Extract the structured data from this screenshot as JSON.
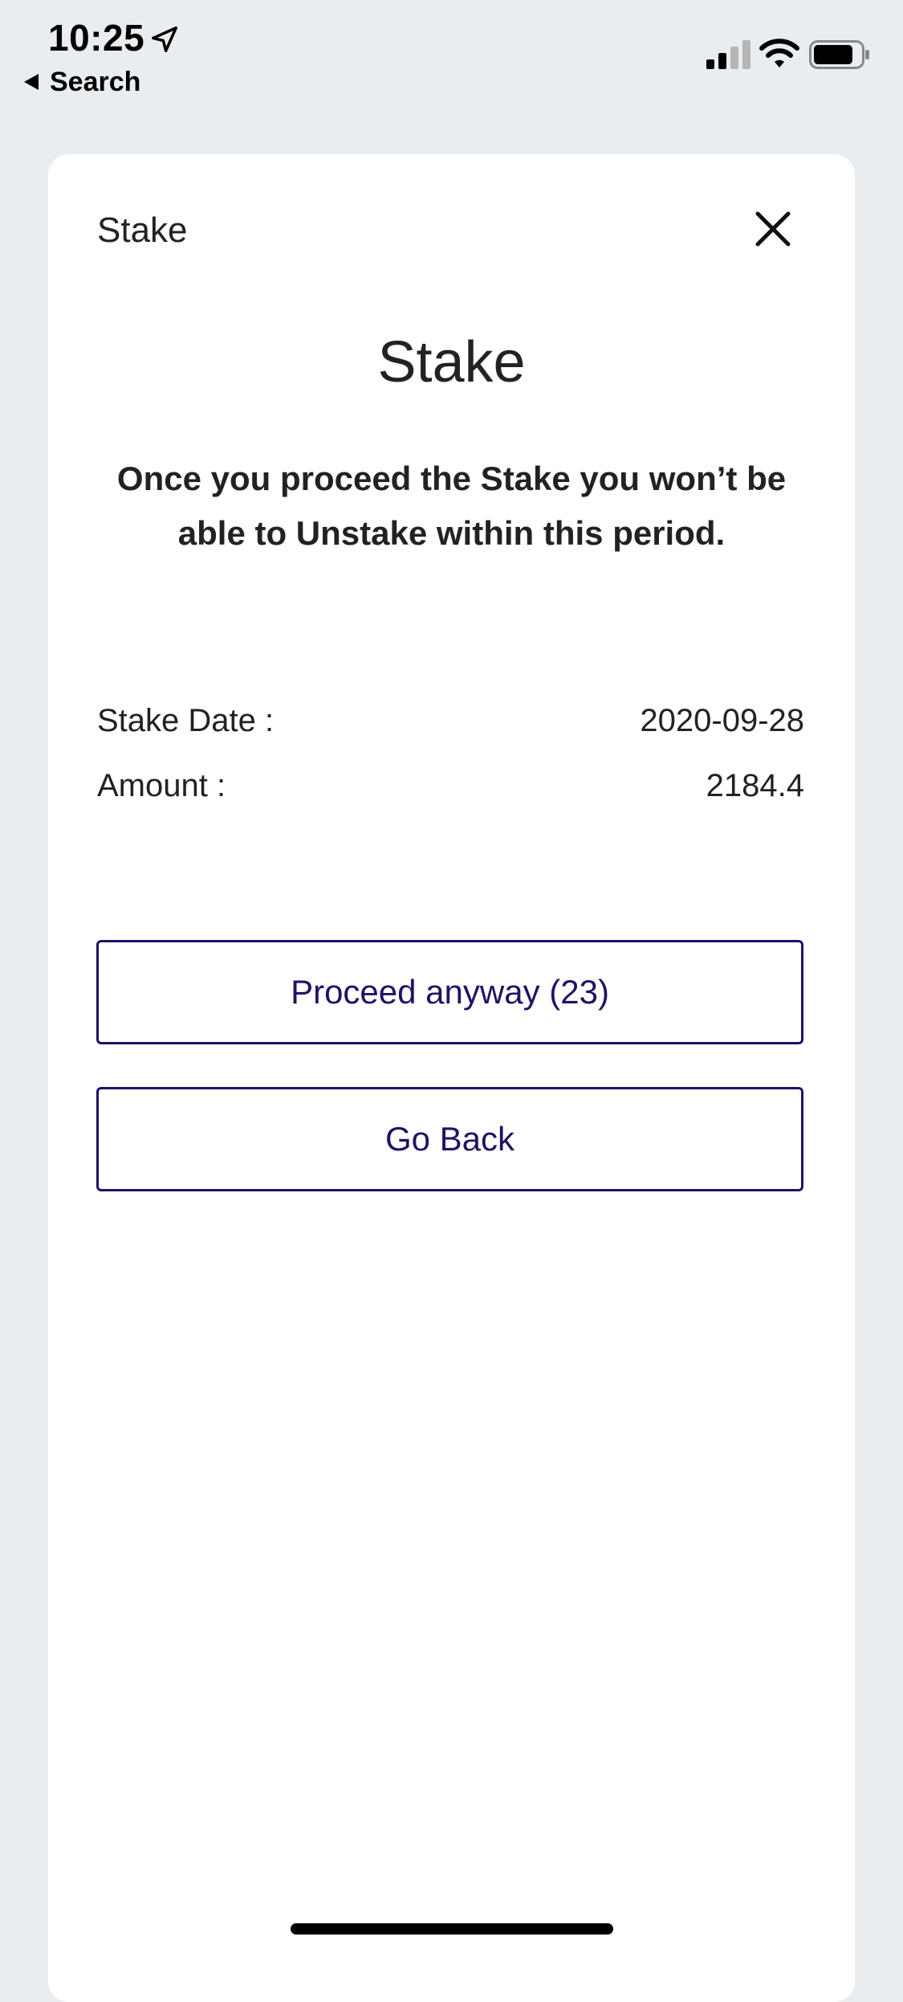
{
  "status_bar": {
    "time": "10:25",
    "back_app_label": "Search",
    "icons": [
      "location-arrow-icon",
      "cellular-signal-icon",
      "wifi-icon",
      "battery-icon"
    ]
  },
  "sheet": {
    "header_title": "Stake",
    "close_icon": "close-icon",
    "title": "Stake",
    "warning": "Once you proceed the Stake you won’t be able to Unstake within this period.",
    "details": {
      "stake_date_label": "Stake Date :",
      "stake_date_value": "2020-09-28",
      "amount_label": "Amount :",
      "amount_value": "2184.4"
    },
    "buttons": {
      "proceed_label": "Proceed anyway (23)",
      "go_back_label": "Go Back"
    }
  },
  "colors": {
    "background": "#eaedf0",
    "sheet": "#ffffff",
    "accent": "#1c1466",
    "text": "#222222"
  }
}
